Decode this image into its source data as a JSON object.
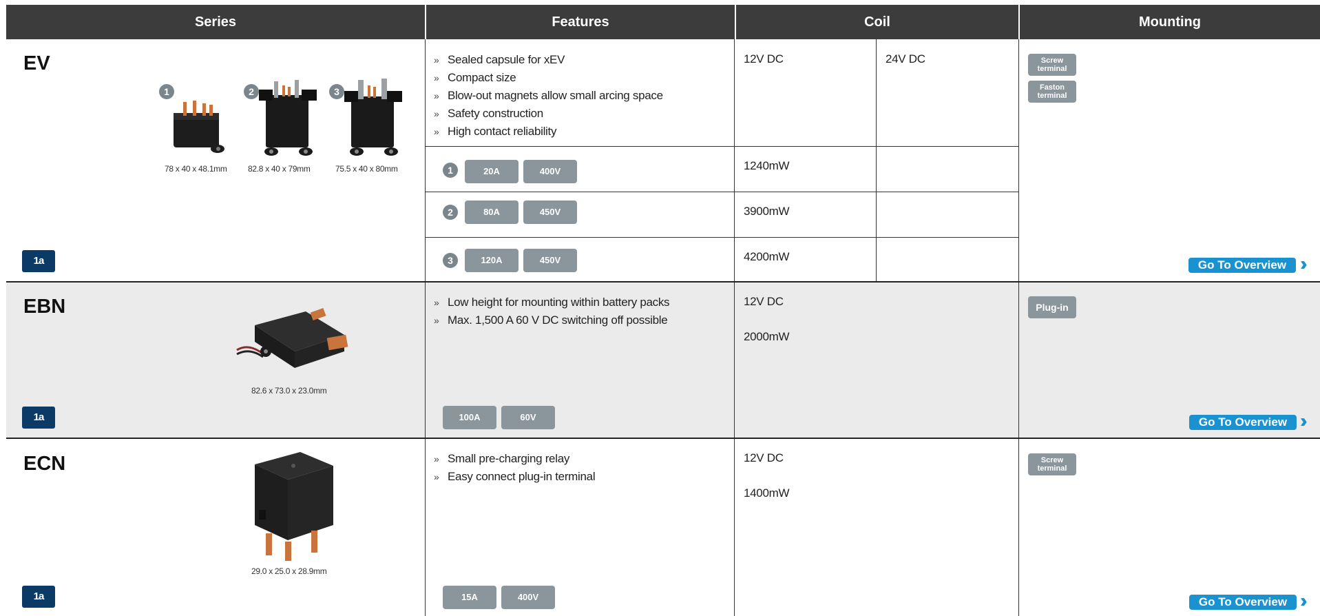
{
  "header": {
    "series": "Series",
    "features": "Features",
    "coil": "Coil",
    "mounting": "Mounting"
  },
  "ev": {
    "name": "EV",
    "badge": "1a",
    "images": [
      {
        "num": "1",
        "dim": "78 x 40 x 48.1mm"
      },
      {
        "num": "2",
        "dim": "82.8 x 40 x 79mm"
      },
      {
        "num": "3",
        "dim": "75.5 x 40 x 80mm"
      }
    ],
    "features": [
      "Sealed capsule for xEV",
      "Compact size",
      "Blow-out magnets allow small arcing space",
      "Safety construction",
      "High contact reliability"
    ],
    "coil_12": "12V DC",
    "coil_24": "24V DC",
    "variants": [
      {
        "num": "1",
        "current": "20A",
        "voltage": "400V",
        "power": "1240mW"
      },
      {
        "num": "2",
        "current": "80A",
        "voltage": "450V",
        "power": "3900mW"
      },
      {
        "num": "3",
        "current": "120A",
        "voltage": "450V",
        "power": "4200mW"
      }
    ],
    "mounting": [
      "Screw terminal",
      "Faston terminal"
    ],
    "goto": "Go To Overview"
  },
  "ebn": {
    "name": "EBN",
    "badge": "1a",
    "dim": "82.6 x 73.0 x 23.0mm",
    "features": [
      "Low height for mounting within battery packs",
      "Max. 1,500 A 60 V DC switching off possible"
    ],
    "coil": "12V DC",
    "power": "2000mW",
    "current": "100A",
    "voltage": "60V",
    "mounting": "Plug-in",
    "goto": "Go To Overview"
  },
  "ecn": {
    "name": "ECN",
    "badge": "1a",
    "dim": "29.0 x 25.0 x 28.9mm",
    "features": [
      "Small pre-charging relay",
      "Easy connect plug-in terminal"
    ],
    "coil": "12V DC",
    "power": "1400mW",
    "current": "15A",
    "voltage": "400V",
    "mounting": "Screw terminal",
    "goto": "Go To Overview"
  },
  "colors": {
    "header_bg": "#3c3c3c",
    "pill": "#8a959c",
    "badge": "#0b3a66",
    "accent": "#1a92d0",
    "alt_row": "#ebebeb"
  }
}
